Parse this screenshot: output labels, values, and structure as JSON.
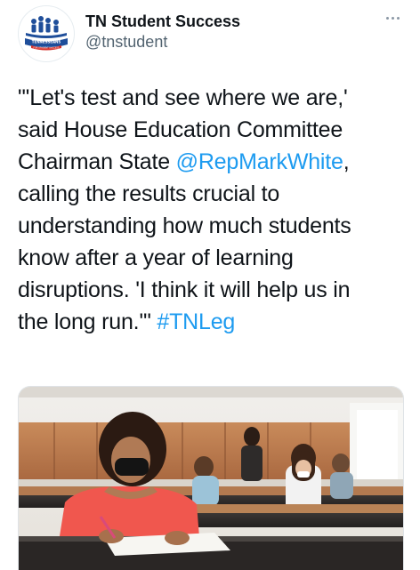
{
  "account": {
    "display_name": "TN Student Success",
    "handle": "@tnstudent",
    "avatar_text": "TENNESSEANS FOR STUDENT SUCCESS"
  },
  "tweet": {
    "lines": [
      [
        "\"'Let's test and see where we are,'"
      ],
      [
        "said House Education Committee"
      ],
      [
        "Chairman State ",
        "@RepMarkWhite",
        ","
      ],
      [
        "calling the results crucial to"
      ],
      [
        "understanding how much students"
      ],
      [
        "know after a year of learning"
      ],
      [
        "disruptions. 'I think it will help us in"
      ],
      [
        "the long run.'\" ",
        "#TNLeg"
      ]
    ],
    "mention": "@RepMarkWhite",
    "hashtag": "#TNLeg"
  },
  "media": {
    "description_icon": "classroom-photo"
  },
  "colors": {
    "link": "#1d9bf0",
    "brand_blue": "#1f4e9a",
    "brand_red": "#d6322b"
  }
}
